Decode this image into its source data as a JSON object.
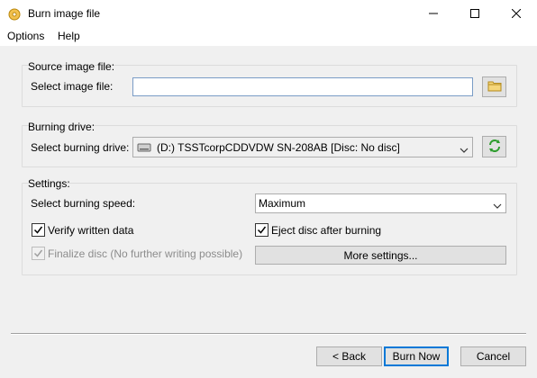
{
  "window": {
    "title": "Burn image file",
    "icon": "disc-icon",
    "controls": [
      "minimize-icon",
      "maximize-icon",
      "close-icon"
    ]
  },
  "menu": {
    "items": [
      {
        "label": "Options"
      },
      {
        "label": "Help"
      }
    ]
  },
  "source": {
    "group_title": "Source image file:",
    "label": "Select image file:",
    "value": "",
    "browse_icon": "folder-icon"
  },
  "drive": {
    "group_title": "Burning drive:",
    "label": "Select burning drive:",
    "selected": "(D:) TSSTcorpCDDVDW SN-208AB [Disc: No disc]",
    "drive_icon": "drive-icon",
    "refresh_icon": "refresh-icon"
  },
  "settings": {
    "group_title": "Settings:",
    "speed_label": "Select burning speed:",
    "speed_value": "Maximum",
    "verify": {
      "label": "Verify written data",
      "checked": true
    },
    "eject": {
      "label": "Eject disc after burning",
      "checked": true
    },
    "finalize": {
      "label": "Finalize disc (No further writing possible)",
      "checked": true,
      "disabled": true
    },
    "more_settings": "More settings..."
  },
  "footer": {
    "back": "< Back",
    "burn": "Burn Now",
    "cancel": "Cancel"
  },
  "colors": {
    "accent": "#0078d7",
    "check_green": "#2a9d2a"
  }
}
